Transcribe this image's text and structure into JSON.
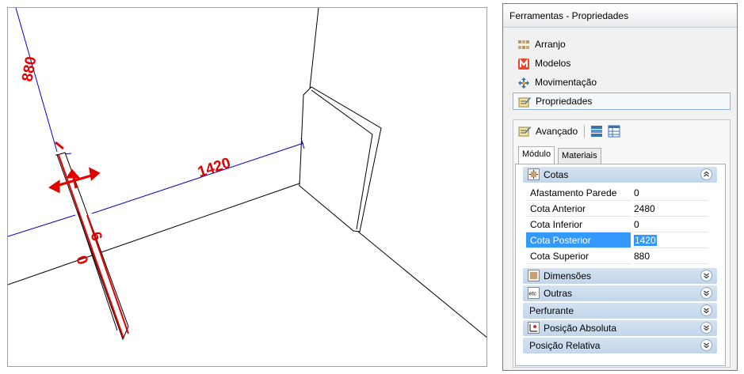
{
  "viewport": {
    "dimensions": [
      "880",
      "1420",
      "6",
      "0"
    ]
  },
  "panel": {
    "title": "Ferramentas - Propriedades",
    "nav": [
      {
        "label": "Arranjo",
        "icon": "arranjo-icon"
      },
      {
        "label": "Modelos",
        "icon": "modelos-icon"
      },
      {
        "label": "Movimentação",
        "icon": "movimentacao-icon"
      },
      {
        "label": "Propriedades",
        "icon": "propriedades-icon",
        "selected": true
      }
    ],
    "advanced": {
      "label": "Avançado",
      "tabs": [
        "Módulo",
        "Materiais"
      ],
      "groups": {
        "cotas": {
          "label": "Cotas",
          "rows": [
            {
              "name": "Afastamento Parede",
              "value": "0"
            },
            {
              "name": "Cota Anterior",
              "value": "2480"
            },
            {
              "name": "Cota Inferior",
              "value": "0"
            },
            {
              "name": "Cota Posterior",
              "value": "1420",
              "selected": true
            },
            {
              "name": "Cota Superior",
              "value": "880"
            }
          ]
        },
        "collapsed": [
          {
            "label": "Dimensões",
            "icon": "dimensoes-icon"
          },
          {
            "label": "Outras",
            "icon": "etc-icon"
          },
          {
            "label": "Perfurante",
            "icon": ""
          },
          {
            "label": "Posição Absoluta",
            "icon": "posicao-absoluta-icon"
          },
          {
            "label": "Posição Relativa",
            "icon": ""
          }
        ]
      }
    }
  },
  "colors": {
    "dimension_text": "#e00000",
    "dimension_line": "#0000cc",
    "selection": "#3399ff",
    "group_header": "#c9dbee"
  }
}
